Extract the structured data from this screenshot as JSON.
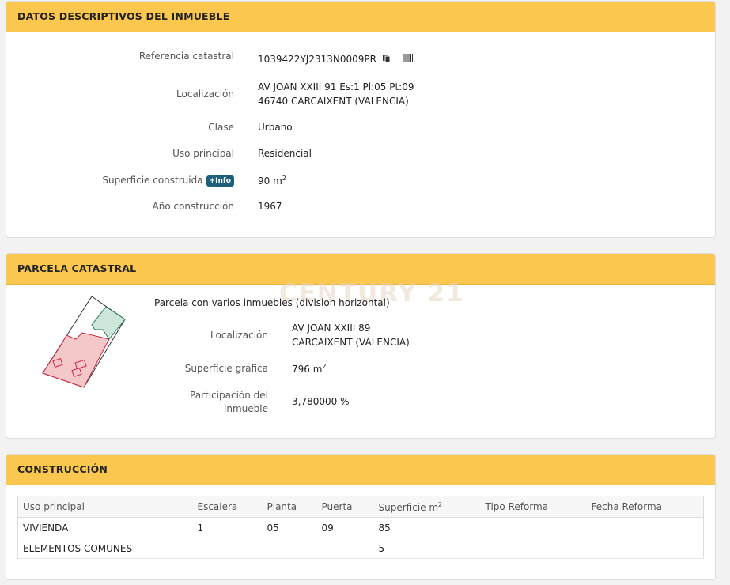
{
  "datos": {
    "title": "DATOS DESCRIPTIVOS DEL INMUEBLE",
    "ref_label": "Referencia catastral",
    "ref_value": "1039422YJ2313N0009PR",
    "loc_label": "Localización",
    "loc_line1": "AV JOAN XXIII 91 Es:1 Pl:05 Pt:09",
    "loc_line2": "46740 CARCAIXENT (VALENCIA)",
    "clase_label": "Clase",
    "clase_value": "Urbano",
    "uso_label": "Uso principal",
    "uso_value": "Residencial",
    "sup_label": "Superficie construida",
    "info_badge": "+Info",
    "sup_value": "90 m",
    "sup_unit_exp": "2",
    "anio_label": "Año construcción",
    "anio_value": "1967"
  },
  "parcela": {
    "title": "PARCELA CATASTRAL",
    "watermark": "CENTURY 21",
    "desc": "Parcela con varios inmuebles (division horizontal)",
    "loc_label": "Localización",
    "loc_line1": "AV JOAN XXIII 89",
    "loc_line2": "CARCAIXENT (VALENCIA)",
    "sup_label": "Superficie gráfica",
    "sup_value": "796 m",
    "sup_unit_exp": "2",
    "part_label_line1": "Participación del",
    "part_label_line2": "inmueble",
    "part_value": "3,780000 %"
  },
  "construccion": {
    "title": "CONSTRUCCIÓN",
    "headers": [
      "Uso principal",
      "Escalera",
      "Planta",
      "Puerta",
      "Superficie m",
      "Tipo Reforma",
      "Fecha Reforma"
    ],
    "sup_header_exp": "2",
    "rows": [
      [
        "VIVIENDA",
        "1",
        "05",
        "09",
        "85",
        "",
        ""
      ],
      [
        "ELEMENTOS COMUNES",
        "",
        "",
        "",
        "5",
        "",
        ""
      ]
    ]
  },
  "icons": {
    "copy": "copy-icon",
    "barcode": "barcode-icon"
  },
  "colors": {
    "header_bg": "#fcc74e",
    "badge_bg": "#1f5f7a",
    "parcel_pink": "#f4c7c9",
    "parcel_green": "#cde6d9"
  }
}
